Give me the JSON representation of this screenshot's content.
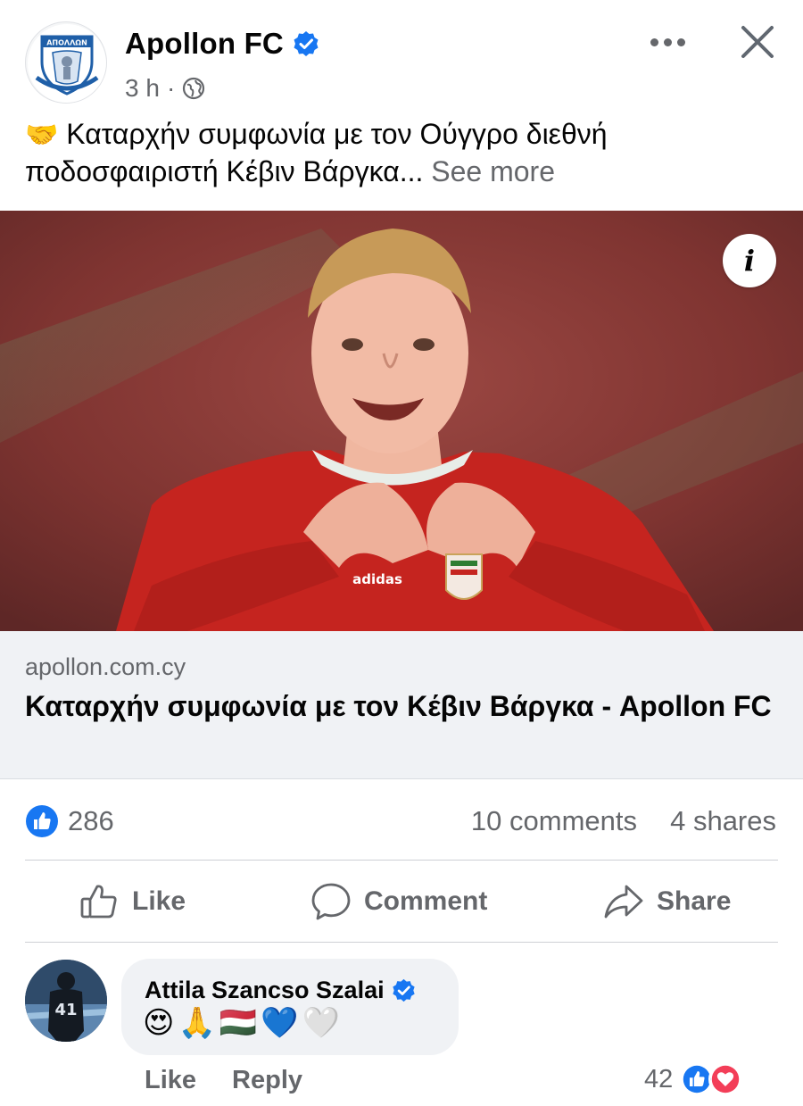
{
  "post": {
    "page_name": "Apollon FC",
    "time_ago": "3 h",
    "separator": "·",
    "caption_emoji": "🤝",
    "caption_text": "Καταρχήν συμφωνία με τον Ούγγρο διεθνή ποδοσφαιριστή Κέβιν Βάργκα...",
    "see_more_label": "See more"
  },
  "image": {
    "info_label": "i"
  },
  "link_preview": {
    "domain": "apollon.com.cy",
    "title": "Καταρχήν συμφωνία με τον Κέβιν Βάργκα - Apollon FC"
  },
  "stats": {
    "like_count": "286",
    "comments": "10 comments",
    "shares": "4 shares"
  },
  "actions": {
    "like_label": "Like",
    "comment_label": "Comment",
    "share_label": "Share"
  },
  "comment": {
    "author": "Attila Szancso Szalai",
    "text": "😍🙏🇭🇺💙🤍",
    "like_label": "Like",
    "reply_label": "Reply",
    "reaction_count": "42"
  },
  "colors": {
    "facebook_blue": "#1877f2",
    "secondary_text": "#65676b",
    "love_red": "#f33e58",
    "bubble_bg": "#f0f2f5"
  },
  "icons": {
    "verified": "verified-badge-icon",
    "audience": "globe-icon",
    "more": "more-options-icon",
    "close": "close-icon",
    "like": "thumbs-up-icon",
    "comment": "comment-bubble-icon",
    "share": "share-arrow-icon",
    "love": "heart-icon"
  }
}
